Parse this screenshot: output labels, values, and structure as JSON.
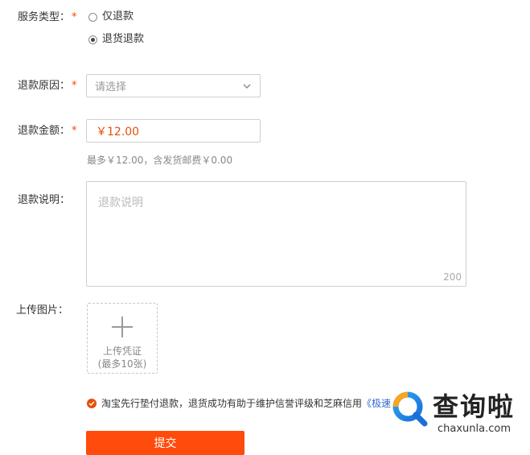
{
  "form": {
    "service_type": {
      "label": "服务类型：",
      "required_mark": "*",
      "options": [
        {
          "label": "仅退款",
          "selected": false
        },
        {
          "label": "退货退款",
          "selected": true
        }
      ]
    },
    "reason": {
      "label": "退款原因：",
      "required_mark": "*",
      "placeholder": "请选择"
    },
    "amount": {
      "label": "退款金额：",
      "required_mark": "*",
      "value": "￥12.00",
      "hint": "最多￥12.00，含发货邮费￥0.00"
    },
    "description": {
      "label": "退款说明：",
      "placeholder": "退款说明",
      "counter": "200"
    },
    "upload": {
      "label": "上传图片：",
      "button_line1": "上传凭证",
      "button_line2": "(最多10张)"
    },
    "agreement": {
      "text": "淘宝先行垫付退款，退货成功有助于维护信誉评级和芝麻信用",
      "link": "《极速"
    },
    "submit_label": "提交"
  },
  "watermark": {
    "text": "查询啦",
    "url": "chaxunla.com"
  },
  "colors": {
    "accent": "#ff4b0b",
    "required": "#ff4400",
    "link": "#3366cc"
  }
}
